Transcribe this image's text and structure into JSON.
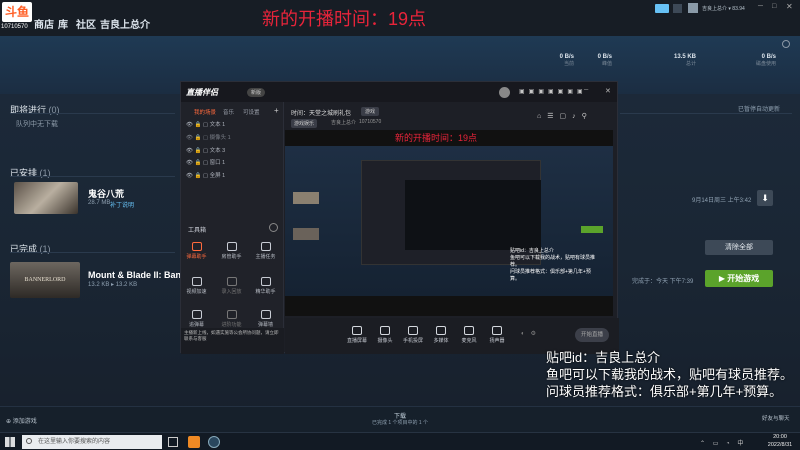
{
  "logo": {
    "text": "斗鱼",
    "room_id": "10710570"
  },
  "steam_nav": {
    "items": [
      "商店",
      "库",
      "社区",
      "吉良上总介"
    ],
    "account": "吉良上总介 ▾ 83.94"
  },
  "overlay_title": "新的开播时间：19点",
  "download_stats": [
    {
      "value": "0 B/s",
      "label": "当前"
    },
    {
      "value": "0 B/s",
      "label": "峰值"
    },
    {
      "value": "13.5 KB",
      "label": "总计"
    },
    {
      "value": "0 B/s",
      "label": "磁盘使用"
    }
  ],
  "sections": {
    "in_progress": {
      "title": "即将进行",
      "count": "(0)",
      "sub": "队列中无下载",
      "right": "已暂停自动更新"
    },
    "scheduled": {
      "title": "已安排",
      "count": "(1)"
    },
    "completed": {
      "title": "已完成",
      "count": "(1)",
      "clear_btn": "清除全部"
    }
  },
  "games": [
    {
      "title": "鬼谷八荒",
      "size": "28.7 MB",
      "tag": "补丁说明",
      "schedule": "9月14日周三 上午3:42"
    },
    {
      "title": "Mount & Blade II: Bannerl",
      "size": "13.2 KB",
      "size2": "13.2 KB",
      "time": "完成于：今天 下午7:39",
      "play_btn": "开始游戏",
      "logo_text": "BANNERLORD"
    }
  ],
  "obs": {
    "title": "直播伴侣",
    "badge": "新版",
    "tabs": [
      "我的场景",
      "音乐",
      "可设置"
    ],
    "layers": [
      "文本 1",
      "摄像头 1",
      "文本 3",
      "窗口 1",
      "全屏 1"
    ],
    "room_title": "时间：天堂之城刷礼包",
    "room_tag": "游戏",
    "room_cat": "游戏娱乐",
    "room_user": "吉良上总介",
    "room_id": "10710570",
    "tools_header": "工具箱",
    "tools": [
      "弹幕助手",
      "房管助手",
      "主播任务",
      "视频加速",
      "录入回放",
      "精华助手",
      "追弹幕",
      "进阶功能",
      "弹幕墙",
      "直播数据",
      "更多功能",
      "设置"
    ],
    "notice": "主播新上线，如遇实施等公会所协问题，请立即联系与客服",
    "bottom_items": [
      "直播屏幕",
      "摄像头",
      "手机投屏",
      "多媒体",
      "麦克风",
      "扬声器"
    ],
    "start_btn": "开始直播",
    "preview_overlay": "新的开播时间：19点"
  },
  "overlay_lines": [
    "贴吧id：吉良上总介",
    "鱼吧可以下载我的战术，贴吧有球员推荐。",
    "问球员推荐格式：俱乐部+第几年+预算。"
  ],
  "footer": {
    "left": "添加游戏",
    "center": "下载",
    "center_sub": "已完成 1 个项目中的 1 个",
    "right": "好友与聊天"
  },
  "taskbar": {
    "search_placeholder": "在这里输入你要搜索的内容",
    "time": "20:00",
    "date": "2022/8/31"
  }
}
